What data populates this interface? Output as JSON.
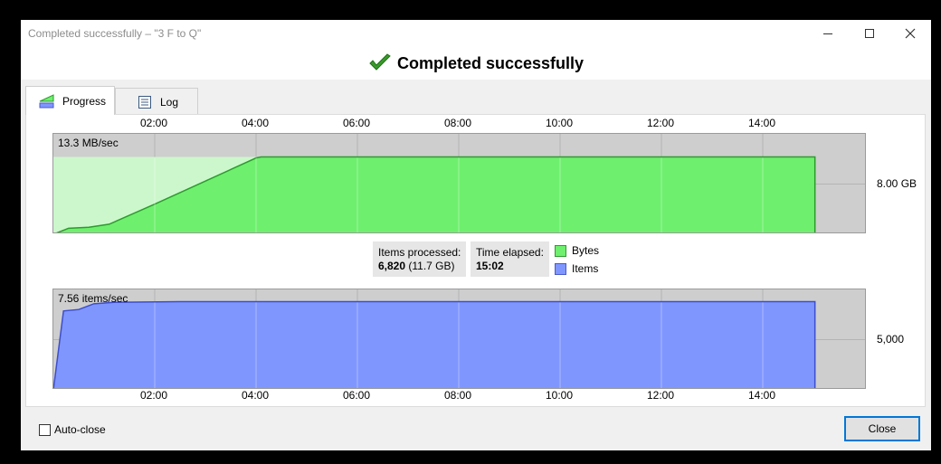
{
  "window": {
    "title": "Completed successfully – \"3 F to Q\"",
    "buttons": {
      "minimize_icon": "minimize-icon",
      "maximize_icon": "maximize-icon",
      "close_icon": "close-icon"
    }
  },
  "banner": {
    "text": "Completed successfully",
    "icon": "checkmark-icon",
    "icon_color": "#3a9a2a"
  },
  "tabs": [
    {
      "label": "Progress",
      "icon": "chart-icon",
      "selected": true
    },
    {
      "label": "Log",
      "icon": "log-icon",
      "selected": false
    }
  ],
  "time_ticks": [
    "02:00",
    "04:00",
    "06:00",
    "08:00",
    "10:00",
    "12:00",
    "14:00"
  ],
  "stats": {
    "items_processed_label": "Items processed:",
    "items_processed_value": "6,820",
    "items_processed_size": "(11.7 GB)",
    "time_elapsed_label": "Time elapsed:",
    "time_elapsed_value": "15:02"
  },
  "legend": [
    {
      "label": "Bytes",
      "color": "#6ef06e"
    },
    {
      "label": "Items",
      "color": "#8096ff"
    }
  ],
  "chart_data": [
    {
      "type": "area",
      "series": [
        {
          "name": "Bytes",
          "color": "#6ef06e"
        }
      ],
      "rate_label": "13.3 MB/sec",
      "y_label": "8.00 GB",
      "x_unit": "minutes",
      "x": [
        0,
        0.3,
        0.7,
        1.1,
        2.0,
        3.0,
        4.0,
        4.1,
        15.03
      ],
      "y": [
        0.0,
        0.6,
        0.7,
        1.0,
        3.0,
        5.3,
        7.6,
        7.7,
        7.7
      ],
      "xlim": [
        0,
        16
      ],
      "ylim": [
        0,
        10
      ],
      "grid": true
    },
    {
      "type": "area",
      "series": [
        {
          "name": "Items",
          "color": "#8096ff"
        }
      ],
      "rate_label": "7.56 items/sec",
      "y_label": "5,000",
      "x_unit": "minutes",
      "x": [
        0,
        0.2,
        0.5,
        0.8,
        1.2,
        2.5,
        15.03
      ],
      "y": [
        0,
        5500,
        5600,
        6000,
        6100,
        6150,
        6150
      ],
      "xlim": [
        0,
        16
      ],
      "ylim": [
        0,
        7000
      ],
      "grid": true
    }
  ],
  "footer": {
    "autoclose_label": "Auto-close",
    "autoclose_checked": false,
    "close_label": "Close"
  }
}
